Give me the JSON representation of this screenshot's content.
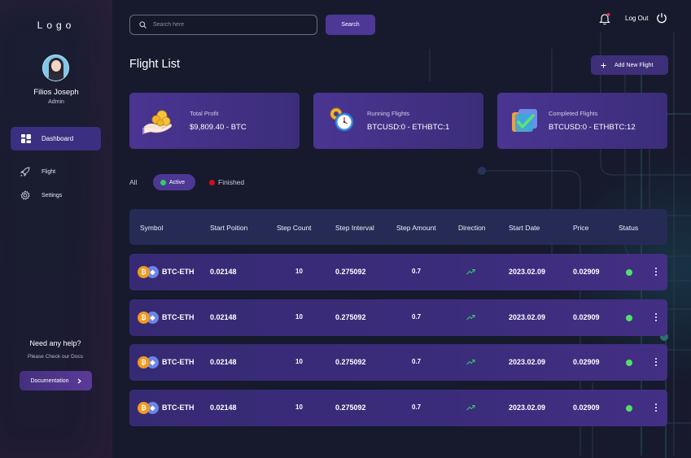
{
  "sidebar": {
    "logo": "Logo",
    "user": {
      "name": "Filios Joseph",
      "role": "Admin"
    },
    "nav": [
      {
        "label": "Dashboard",
        "icon": "dashboard-icon",
        "active": true
      },
      {
        "label": "Flight",
        "icon": "rocket-icon",
        "active": false
      },
      {
        "label": "Settings",
        "icon": "gear-icon",
        "active": false
      }
    ],
    "help": {
      "title": "Need any help?",
      "subtitle": "Please Check our Docs",
      "button": "Documentation"
    }
  },
  "topbar": {
    "search_placeholder": "Search here",
    "search_value": "",
    "search_button": "Search",
    "logout": "Log Out"
  },
  "page": {
    "title": "Flight List",
    "add_button": "Add New Flight"
  },
  "cards": [
    {
      "label": "Total Profit",
      "value": "$9,809.40  - BTC",
      "icon": "money-hand-icon"
    },
    {
      "label": "Running Flights",
      "value": "BTCUSD:0 - ETHBTC:1",
      "icon": "clock-gear-icon"
    },
    {
      "label": "Completed Flights",
      "value": "BTCUSD:0  - ETHBTC:12",
      "icon": "checkbox-icon"
    }
  ],
  "filters": {
    "all": "All",
    "active": "Active",
    "finished": "Finished"
  },
  "colors": {
    "accent": "#4c3894",
    "active_dot": "#2fcf6a",
    "finished_dot": "#d0101a",
    "status_ok": "#50e06b",
    "trend_up": "#2fcf6a"
  },
  "table": {
    "columns": [
      "Symbol",
      "Start Poition",
      "Step Count",
      "Step Interval",
      "Step Amount",
      "Direction",
      "Start Date",
      "Price",
      "Status"
    ],
    "rows": [
      {
        "symbol": "BTC-ETH",
        "start_position": "0.02148",
        "step_count": "10",
        "step_interval": "0.275092",
        "step_amount": "0.7",
        "direction": "up",
        "start_date": "2023.02.09",
        "price": "0.02909",
        "status": "active"
      },
      {
        "symbol": "BTC-ETH",
        "start_position": "0.02148",
        "step_count": "10",
        "step_interval": "0.275092",
        "step_amount": "0.7",
        "direction": "up",
        "start_date": "2023.02.09",
        "price": "0.02909",
        "status": "active"
      },
      {
        "symbol": "BTC-ETH",
        "start_position": "0.02148",
        "step_count": "10",
        "step_interval": "0.275092",
        "step_amount": "0.7",
        "direction": "up",
        "start_date": "2023.02.09",
        "price": "0.02909",
        "status": "active"
      },
      {
        "symbol": "BTC-ETH",
        "start_position": "0.02148",
        "step_count": "10",
        "step_interval": "0.275092",
        "step_amount": "0.7",
        "direction": "up",
        "start_date": "2023.02.09",
        "price": "0.02909",
        "status": "active"
      }
    ]
  }
}
